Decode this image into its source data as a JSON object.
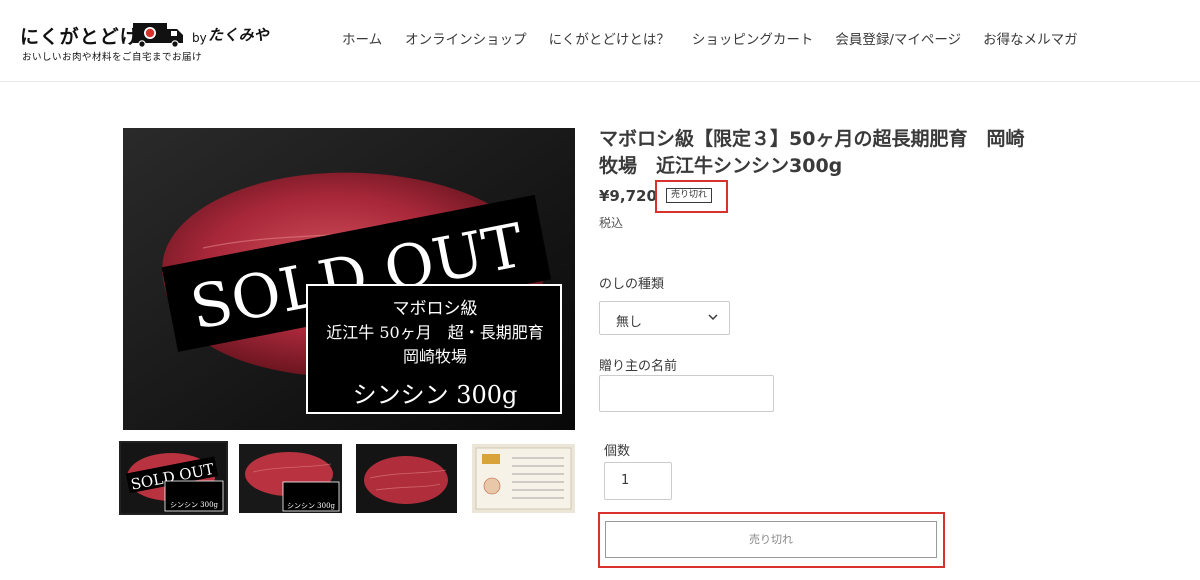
{
  "header": {
    "logo_main": "にくがとどけ",
    "logo_by": "by",
    "logo_brand": "たくみや",
    "logo_tagline": "おいしいお肉や材料をご自宅までお届け"
  },
  "nav": {
    "items": [
      {
        "label": "ホーム"
      },
      {
        "label": "オンラインショップ"
      },
      {
        "label": "にくがとどけとは？"
      },
      {
        "label": "ショッピングカート"
      },
      {
        "label": "会員登録/マイページ"
      },
      {
        "label": "お得なメルマガ"
      }
    ]
  },
  "product_image": {
    "banner_text": "SOLD OUT",
    "caption_line1": "マボロシ級",
    "caption_line2": "近江牛 50ヶ月　超・長期肥育",
    "caption_line3": "岡崎牧場",
    "caption_line4": "シンシン 300g"
  },
  "product": {
    "title": "マボロシ級【限定３】50ヶ月の超長期肥育　岡崎牧場　近江牛シンシン300g",
    "price": "¥9,720",
    "soldout_badge": "売り切れ",
    "tax_note": "税込"
  },
  "options": {
    "noshi_label": "のしの種類",
    "noshi_value": "無し",
    "giver_label": "贈り主の名前",
    "giver_value": "",
    "qty_label": "個数",
    "qty_value": "1",
    "submit_label": "売り切れ"
  },
  "colors": {
    "highlight": "#d9322d",
    "meat": "#b8323f",
    "background_dark": "#0d0d0d"
  }
}
